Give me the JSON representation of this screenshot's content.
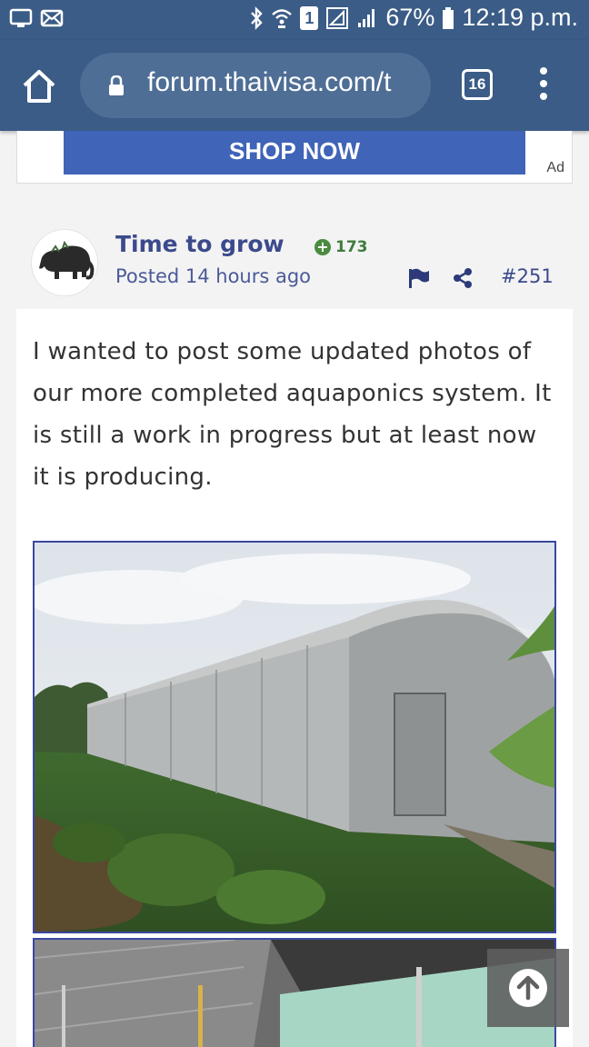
{
  "status_bar": {
    "battery": "67%",
    "time": "12:19 p.m.",
    "sim_label": "1",
    "icons": [
      "screen-icon",
      "mail-icon",
      "bluetooth-icon",
      "wifi-icon",
      "sim-icon",
      "no-signal-icon",
      "signal-icon",
      "battery-icon"
    ]
  },
  "browser": {
    "url": "forum.thaivisa.com/t",
    "tab_count": "16",
    "icons": [
      "home-icon",
      "lock-icon",
      "tabs-icon",
      "more-icon"
    ]
  },
  "ad": {
    "button_label": "SHOP NOW",
    "label": "Ad"
  },
  "post": {
    "author": "Time to grow",
    "reputation": "173",
    "posted": "Posted 14 hours ago",
    "number": "#251",
    "body": "I wanted to post some updated photos of our more completed aquaponics system. It is still a work in progress but at least now it is producing.",
    "icons": [
      "avatar-elephant",
      "reputation-plus-icon",
      "report-flag-icon",
      "share-icon"
    ]
  },
  "colors": {
    "header": "#3a5c86",
    "link": "#3b4a8c",
    "ad_button": "#3f64b8",
    "reputation": "#4b8b3f"
  },
  "scroll_to_top_icon": "arrow-up-icon"
}
